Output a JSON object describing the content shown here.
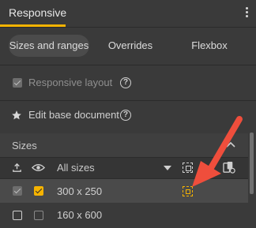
{
  "header": {
    "title": "Responsive"
  },
  "tabs": [
    {
      "label": "Sizes and ranges",
      "active": true
    },
    {
      "label": "Overrides",
      "active": false
    },
    {
      "label": "Flexbox",
      "active": false
    }
  ],
  "options": {
    "responsive_layout": "Responsive layout",
    "edit_base_document": "Edit base document"
  },
  "sizes": {
    "title": "Sizes",
    "filter_value": "All sizes",
    "rows": [
      {
        "label": "300 x 250",
        "selected": true,
        "visible": true
      },
      {
        "label": "160 x 600",
        "selected": false,
        "visible": false
      }
    ]
  },
  "colors": {
    "accent": "#f5b300",
    "arrow": "#ef4e3c",
    "background": "#3a3a3a"
  },
  "icons": [
    "kebab-menu-icon",
    "help-icon",
    "star-icon",
    "chevron-up-icon",
    "upload-icon",
    "eye-icon",
    "dropdown-caret-icon",
    "select-bounds-icon",
    "device-preview-icon"
  ]
}
